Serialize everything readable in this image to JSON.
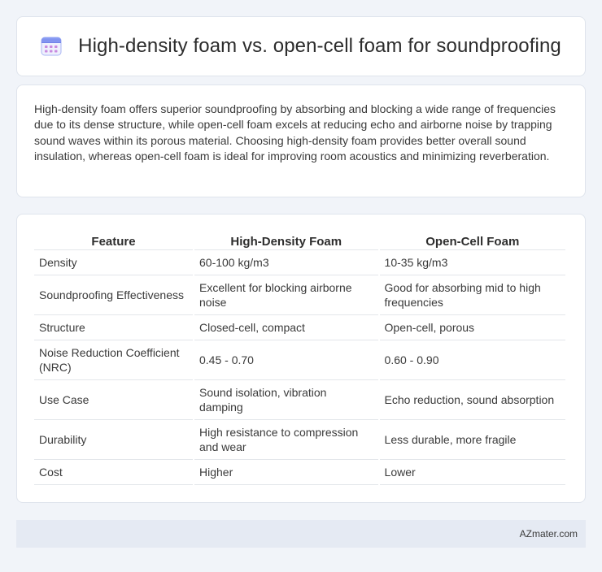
{
  "header": {
    "title": "High-density foam vs. open-cell foam for soundproofing",
    "icon": "calendar-icon"
  },
  "intro": {
    "text": "High-density foam offers superior soundproofing by absorbing and blocking a wide range of frequencies due to its dense structure, while open-cell foam excels at reducing echo and airborne noise by trapping sound waves within its porous material. Choosing high-density foam provides better overall sound insulation, whereas open-cell foam is ideal for improving room acoustics and minimizing reverberation."
  },
  "table": {
    "headers": [
      "Feature",
      "High-Density Foam",
      "Open-Cell Foam"
    ],
    "rows": [
      [
        "Density",
        "60-100 kg/m3",
        "10-35 kg/m3"
      ],
      [
        "Soundproofing Effectiveness",
        "Excellent for blocking airborne noise",
        "Good for absorbing mid to high frequencies"
      ],
      [
        "Structure",
        "Closed-cell, compact",
        "Open-cell, porous"
      ],
      [
        "Noise Reduction Coefficient (NRC)",
        "0.45 - 0.70",
        "0.60 - 0.90"
      ],
      [
        "Use Case",
        "Sound isolation, vibration damping",
        "Echo reduction, sound absorption"
      ],
      [
        "Durability",
        "High resistance to compression and wear",
        "Less durable, more fragile"
      ],
      [
        "Cost",
        "Higher",
        "Lower"
      ]
    ]
  },
  "footer": {
    "site": "AZmater.com"
  },
  "colors": {
    "background": "#f1f4f9",
    "footer_bg": "#e5eaf3",
    "icon_accent": "#7b8ff0"
  }
}
